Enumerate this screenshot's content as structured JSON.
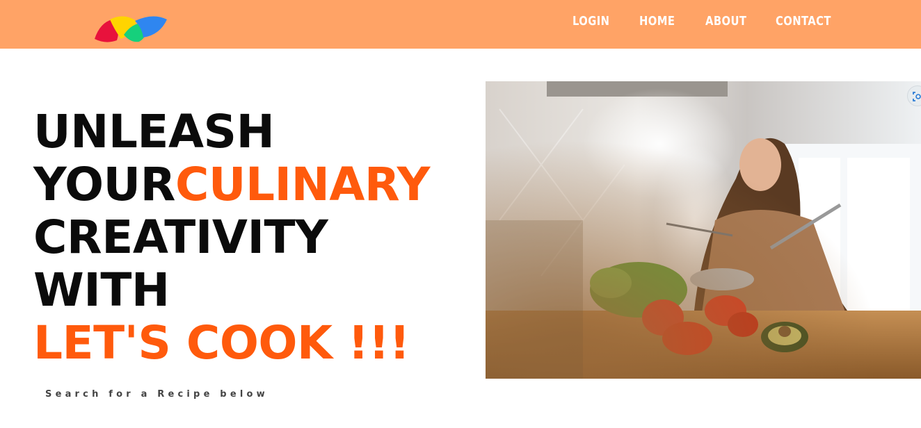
{
  "navbar": {
    "logo_icon": "colorful-petals-logo-icon",
    "links": [
      "LOGIN",
      "HOME",
      "ABOUT",
      "CONTACT"
    ],
    "background_color": "#ffa366"
  },
  "hero": {
    "line1": "UNLEASH",
    "line2_a": "YOUR",
    "line2_b": "CULINARY",
    "line3": "CREATIVITY",
    "line4": "WITH",
    "line5": "LET'S COOK !!!",
    "accent_color": "#ff5a0c",
    "search_caption": "Search for a Recipe below"
  },
  "photo": {
    "subject": "woman-cooking-in-kitchen-image",
    "visual_search_icon": "visual-search-icon"
  }
}
